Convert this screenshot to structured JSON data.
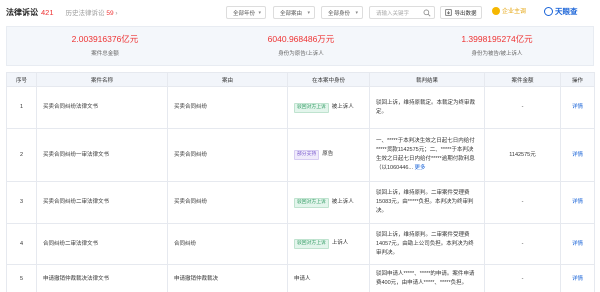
{
  "header": {
    "title": "法律诉讼",
    "count": "421",
    "history_label": "历史法律诉讼",
    "history_count": "59",
    "history_suffix": "›"
  },
  "filters": [
    {
      "label": "全部年份",
      "caret": "▾"
    },
    {
      "label": "全部案由",
      "caret": "▾"
    },
    {
      "label": "全部身份",
      "caret": "▾"
    }
  ],
  "search": {
    "placeholder": "请输入关键字"
  },
  "toolbar": {
    "export_label": "导出数据",
    "vip_label": "企业主调",
    "logo_text": "天眼查"
  },
  "summary": [
    {
      "value": "2.003916376亿元",
      "label": "案件总金额"
    },
    {
      "value": "6040.968486万元",
      "label": "身份为原告/上诉人"
    },
    {
      "value": "1.3998195274亿元",
      "label": "身份为被告/被上诉人"
    }
  ],
  "table": {
    "headers": [
      "序号",
      "案件名称",
      "案由",
      "在本案中身份",
      "裁判结果",
      "案件金额",
      "操作"
    ],
    "rows": [
      {
        "index": "1",
        "name": "买卖合同纠纷法律文书",
        "cause": "买卖合同纠纷",
        "tag": "驳回对方上诉",
        "tag_color": "green",
        "role": "被上诉人",
        "result": "驳回上诉，维持原裁定。本裁定为终审裁定。",
        "more": "",
        "amount": "-",
        "action": "详情"
      },
      {
        "index": "2",
        "name": "买卖合同纠纷一审法律文书",
        "cause": "买卖合同纠纷",
        "tag": "部分支持",
        "tag_color": "purple",
        "role": "原告",
        "result": "一、*****于本判决生效之日起七日内给付*****货款1142575元；二、*****于本判决生效之日起七日内给付*****逾期付款利息（以1060446...",
        "more": "更多",
        "amount": "1142575元",
        "action": "详情"
      },
      {
        "index": "3",
        "name": "买卖合同纠纷二审法律文书",
        "cause": "买卖合同纠纷",
        "tag": "驳回对方上诉",
        "tag_color": "green",
        "role": "被上诉人",
        "result": "驳回上诉，维持原判。二审案件受理费15083元，由*****负担。本判决为终审判决。",
        "more": "",
        "amount": "-",
        "action": "详情"
      },
      {
        "index": "4",
        "name": "合同纠纷二审法律文书",
        "cause": "合同纠纷",
        "tag": "驳回对方上诉",
        "tag_color": "green",
        "role": "上诉人",
        "result": "驳回上诉，维持原判。二审案件受理费14057元，由勘上公司负担。本判决为终审判决。",
        "more": "",
        "amount": "-",
        "action": "详情"
      },
      {
        "index": "5",
        "name": "申请撤销仲裁裁决法律文书",
        "cause": "申请撤销仲裁裁决",
        "tag": "",
        "tag_color": "",
        "role": "申请人",
        "result": "驳回申请人*****、*****的申请。案件申请费400元，由申请人*****、*****负担。",
        "more": "",
        "amount": "-",
        "action": "详情"
      }
    ]
  }
}
